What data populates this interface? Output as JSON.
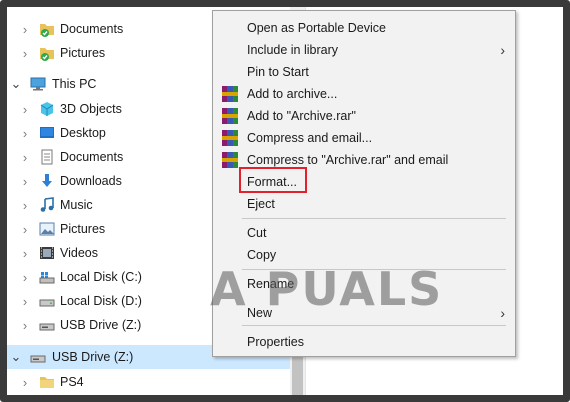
{
  "nav": {
    "items": [
      {
        "label": "Documents",
        "icon": "folder-check-icon"
      },
      {
        "label": "Pictures",
        "icon": "folder-check-icon"
      },
      {
        "label": "This PC",
        "icon": "computer-icon"
      },
      {
        "label": "3D Objects",
        "icon": "3d-objects-icon"
      },
      {
        "label": "Desktop",
        "icon": "desktop-icon"
      },
      {
        "label": "Documents",
        "icon": "documents-icon"
      },
      {
        "label": "Downloads",
        "icon": "downloads-icon"
      },
      {
        "label": "Music",
        "icon": "music-icon"
      },
      {
        "label": "Pictures",
        "icon": "pictures-icon"
      },
      {
        "label": "Videos",
        "icon": "videos-icon"
      },
      {
        "label": "Local Disk (C:)",
        "icon": "windows-drive-icon"
      },
      {
        "label": "Local Disk (D:)",
        "icon": "drive-icon"
      },
      {
        "label": "USB Drive (Z:)",
        "icon": "usb-drive-icon"
      },
      {
        "label": "USB Drive (Z:)",
        "icon": "usb-drive-icon"
      },
      {
        "label": "PS4",
        "icon": "folder-icon"
      }
    ]
  },
  "menu": {
    "items": [
      {
        "label": "Open as Portable Device"
      },
      {
        "label": "Include in library",
        "submenu": true
      },
      {
        "label": "Pin to Start"
      },
      {
        "label": "Add to archive...",
        "icon": "winrar-icon"
      },
      {
        "label": "Add to \"Archive.rar\"",
        "icon": "winrar-icon"
      },
      {
        "label": "Compress and email...",
        "icon": "winrar-icon"
      },
      {
        "label": "Compress to \"Archive.rar\" and email",
        "icon": "winrar-icon"
      },
      {
        "label": "Format..."
      },
      {
        "label": "Eject"
      },
      {
        "label": "Cut"
      },
      {
        "label": "Copy"
      },
      {
        "label": "Rename"
      },
      {
        "label": "New",
        "submenu": true
      },
      {
        "label": "Properties"
      }
    ],
    "submenu_arrow": "›"
  },
  "watermark": "A PUALS",
  "colors": {
    "selection": "#cce8ff",
    "highlight_box": "#e2222a",
    "menu_bg": "#f2f2f2"
  }
}
